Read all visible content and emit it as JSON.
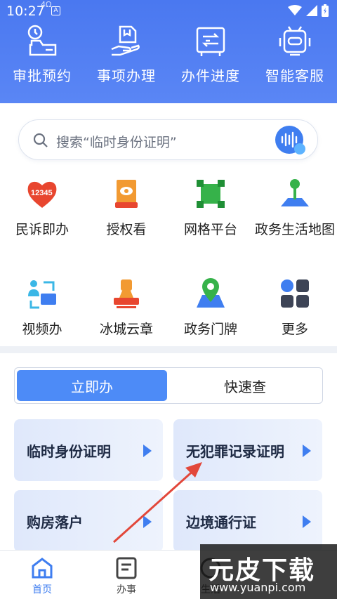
{
  "status": {
    "time": "10:27",
    "sub": "4Ω",
    "a_icon": "A"
  },
  "quick": [
    {
      "label": "审批预约",
      "icon": "approval-icon"
    },
    {
      "label": "事项办理",
      "icon": "handling-icon"
    },
    {
      "label": "办件进度",
      "icon": "progress-icon"
    },
    {
      "label": "智能客服",
      "icon": "robot-icon"
    }
  ],
  "search": {
    "placeholder": "搜索“临时身份证明”"
  },
  "grid": [
    {
      "label": "民诉即办",
      "icon": "12345-icon"
    },
    {
      "label": "授权看",
      "icon": "authorize-view-icon"
    },
    {
      "label": "网格平台",
      "icon": "grid-platform-icon"
    },
    {
      "label": "政务生活地图",
      "icon": "map-pin-icon"
    },
    {
      "label": "视频办",
      "icon": "video-handle-icon"
    },
    {
      "label": "冰城云章",
      "icon": "seal-icon"
    },
    {
      "label": "政务门牌",
      "icon": "location-icon"
    },
    {
      "label": "更多",
      "icon": "more-icon"
    }
  ],
  "tabs": {
    "active": "立即办",
    "inactive": "快速查"
  },
  "cards": [
    {
      "label": "临时身份证明"
    },
    {
      "label": "无犯罪记录证明"
    },
    {
      "label": "购房落户"
    },
    {
      "label": "边境通行证"
    }
  ],
  "nav": [
    {
      "label": "首页"
    },
    {
      "label": "办事"
    },
    {
      "label": "生活"
    }
  ],
  "watermark": {
    "logo": "元皮下载",
    "url": "www.yuanpi.com"
  },
  "colors": {
    "header": "#4a78f0",
    "accent": "#4d8bf7",
    "annotation": "#e2473a"
  }
}
